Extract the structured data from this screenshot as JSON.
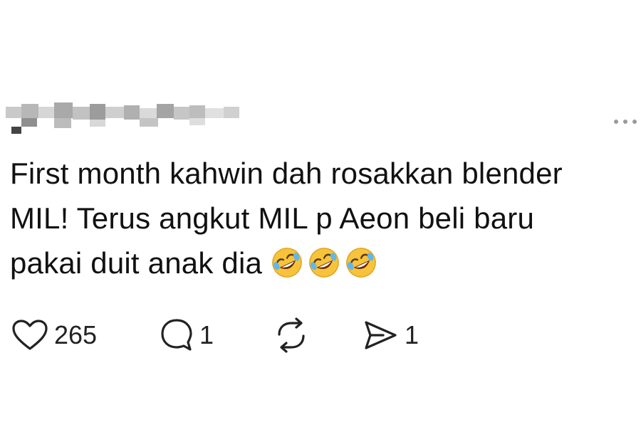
{
  "post": {
    "text": "First month kahwin dah rosakkan blender\nMIL! Terus angkut MIL p Aeon beli baru\npakai duit anak dia ",
    "emojis": [
      "rolling-on-floor-laughing",
      "rolling-on-floor-laughing",
      "rolling-on-floor-laughing"
    ]
  },
  "actions": {
    "like": {
      "icon": "heart-icon",
      "count": "265"
    },
    "comment": {
      "icon": "comment-icon",
      "count": "1"
    },
    "repost": {
      "icon": "repost-icon",
      "count": ""
    },
    "share": {
      "icon": "send-icon",
      "count": "1"
    }
  },
  "colors": {
    "text": "#111111",
    "icon": "#222222",
    "muted": "#9a9a9a",
    "background": "#ffffff",
    "emoji_face": "#f6c33b"
  }
}
